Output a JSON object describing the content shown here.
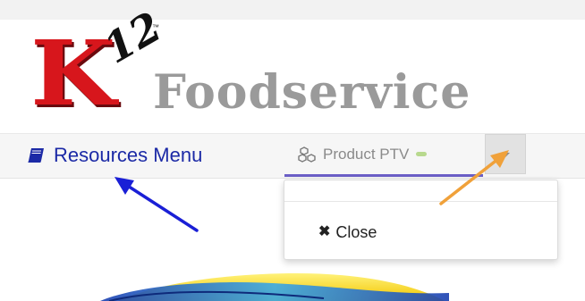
{
  "logo": {
    "brand_k": "K",
    "brand_num": "12",
    "brand_tm": "™",
    "brand_name": "Foodservice",
    "colors": {
      "k": "#d7161c",
      "name": "#9a9a9a"
    }
  },
  "nav": {
    "resources": {
      "label": "Resources Menu",
      "icon": "book-icon",
      "color": "#1c2aa6"
    },
    "product_tab": {
      "label": "Product PTV",
      "icon": "cubes-icon",
      "active_color": "#6b5fc6"
    },
    "dropdown_toggle": {
      "icon": "caret-down-icon"
    }
  },
  "dropdown": {
    "items": [
      {
        "label": "Close",
        "icon": "times-icon"
      }
    ]
  },
  "annotations": {
    "arrow_colors": {
      "blue": "#1a1fd6",
      "orange": "#f0a13a"
    }
  }
}
